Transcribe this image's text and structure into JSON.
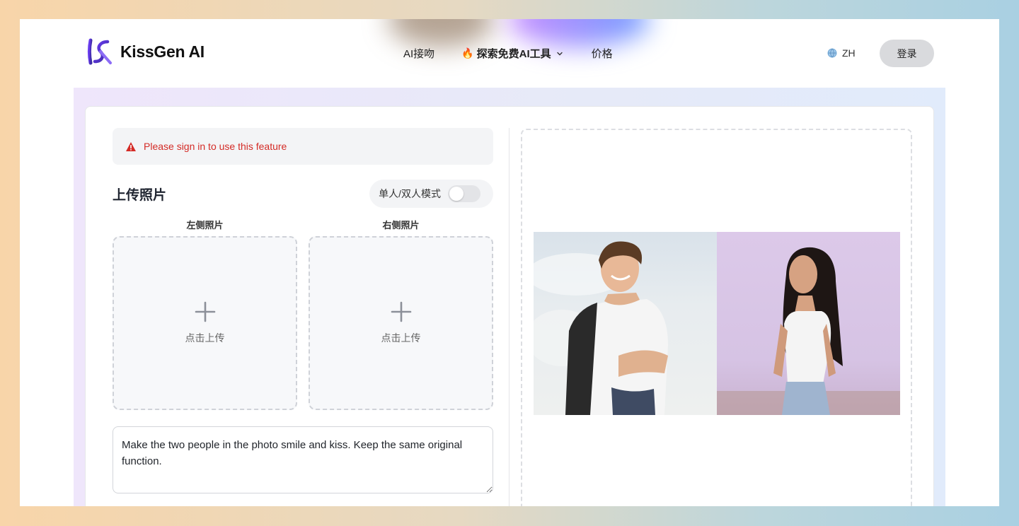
{
  "header": {
    "logo_text": "KissGen AI",
    "nav": [
      {
        "label": "AI接吻"
      },
      {
        "label": "探索免费AI工具",
        "icon": "fire-icon",
        "has_dropdown": true
      },
      {
        "label": "价格"
      }
    ],
    "language": "ZH",
    "login_label": "登录"
  },
  "form": {
    "alert_text": "Please sign in to use this feature",
    "upload_title": "上传照片",
    "mode_label": "单人/双人模式",
    "mode_toggle_on": false,
    "left_photo_label": "左侧照片",
    "right_photo_label": "右侧照片",
    "upload_hint": "点击上传",
    "prompt_text": "Make the two people in the photo smile and kiss. Keep the same original function."
  },
  "preview": {
    "image_description": "example-couple-photo"
  },
  "colors": {
    "alert_red": "#d42b26",
    "login_bg": "#d9dadd"
  }
}
